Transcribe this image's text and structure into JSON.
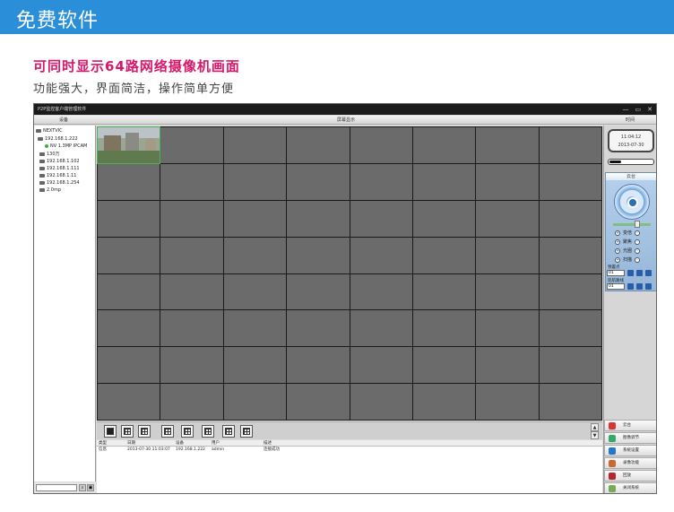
{
  "banner": {
    "title": "免费软件"
  },
  "headline": "可同时显示64路网络摄像机画面",
  "subline": "功能强大，界面简洁，操作简单方便",
  "app": {
    "title": "P2P监控客户端管理软件",
    "window_controls": [
      "—",
      "▭",
      "✕"
    ],
    "headers": {
      "devices": "设备",
      "screen": "屏幕显示",
      "time": "时间"
    },
    "tree": [
      {
        "label": "NEXTVIC",
        "icon": "root-icon"
      },
      {
        "label": "192.168.1.222",
        "icon": "folder-icon"
      },
      {
        "label": "NV 1.3MP IPCAM",
        "icon": "camera-online-icon"
      },
      {
        "label": "130万",
        "icon": "device-icon"
      },
      {
        "label": "192.168.1.102",
        "icon": "device-icon"
      },
      {
        "label": "192.168.1.111",
        "icon": "device-icon"
      },
      {
        "label": "192.168.1.11",
        "icon": "device-icon"
      },
      {
        "label": "192.168.1.254",
        "icon": "device-icon"
      },
      {
        "label": "2.0mp",
        "icon": "device-icon"
      }
    ],
    "clock": {
      "time": "11:04:12",
      "date": "2013-07-30"
    },
    "volume_level": 0.25,
    "ptz": {
      "title": "云台",
      "rows": [
        "变倍",
        "聚焦",
        "光圈",
        "扫描"
      ],
      "preset_label": "预置点",
      "preset_value": "01",
      "cruise_label": "巡航路线",
      "cruise_value": "01"
    },
    "log": {
      "columns": [
        "类型",
        "日期",
        "设备",
        "用户",
        "描述"
      ],
      "rows": [
        {
          "type": "信息",
          "date": "2013-07-30 11:03:07",
          "device": "192.168.1.222",
          "user": "admin",
          "desc": "连接成功"
        }
      ]
    },
    "menu": [
      {
        "label": "云台",
        "color": "#d33"
      },
      {
        "label": "图像调节",
        "color": "#3a6"
      },
      {
        "label": "系统设置",
        "color": "#27c"
      },
      {
        "label": "录像功能",
        "color": "#c63"
      },
      {
        "label": "回放",
        "color": "#b23"
      },
      {
        "label": "关闭系统",
        "color": "#7a5"
      }
    ],
    "colors": {
      "banner": "#2a8fd8",
      "headline": "#d8176a"
    }
  }
}
